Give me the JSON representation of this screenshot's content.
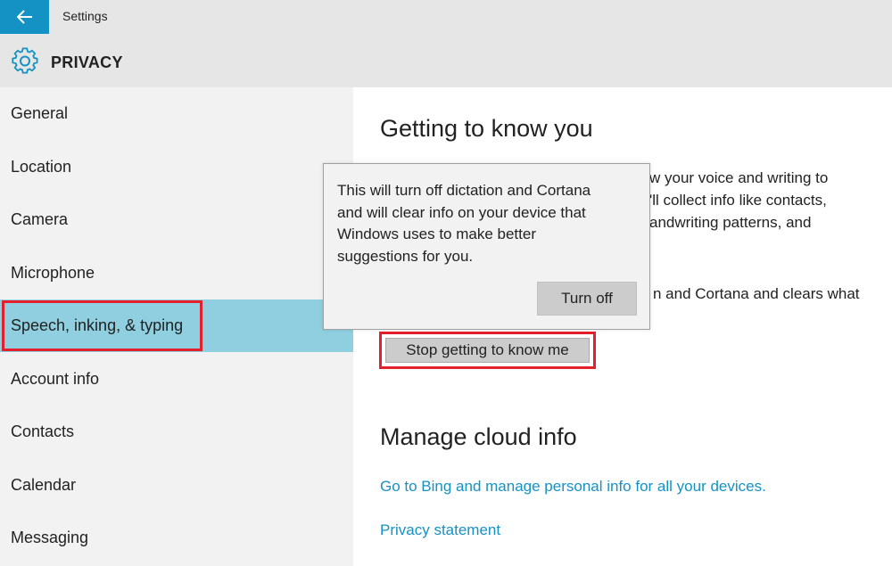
{
  "window": {
    "title": "Settings",
    "back_icon": "back-arrow-icon"
  },
  "header": {
    "icon": "gear-icon",
    "title": "PRIVACY"
  },
  "sidebar": {
    "items": [
      {
        "label": "General"
      },
      {
        "label": "Location"
      },
      {
        "label": "Camera"
      },
      {
        "label": "Microphone"
      },
      {
        "label": "Speech, inking, & typing",
        "selected": true
      },
      {
        "label": "Account info"
      },
      {
        "label": "Contacts"
      },
      {
        "label": "Calendar"
      },
      {
        "label": "Messaging"
      }
    ]
  },
  "main": {
    "section1": {
      "heading": "Getting to know you",
      "text_lines": [
        "w your voice and writing to",
        "'ll collect info like contacts,",
        "andwriting patterns, and"
      ],
      "text_line4": "n and Cortana and clears what",
      "stop_button": "Stop getting to know me"
    },
    "section2": {
      "heading": "Manage cloud info",
      "bing_link": "Go to Bing and manage personal info for all your devices.",
      "privacy_link": "Privacy statement"
    }
  },
  "popup": {
    "lines": [
      "This will turn off dictation and Cortana",
      "and will clear info on your device that",
      "Windows uses to make better",
      "suggestions for you."
    ],
    "button": "Turn off"
  },
  "colors": {
    "accent": "#1592c4",
    "selected": "#8fcfdf",
    "highlight": "#e3202b"
  }
}
